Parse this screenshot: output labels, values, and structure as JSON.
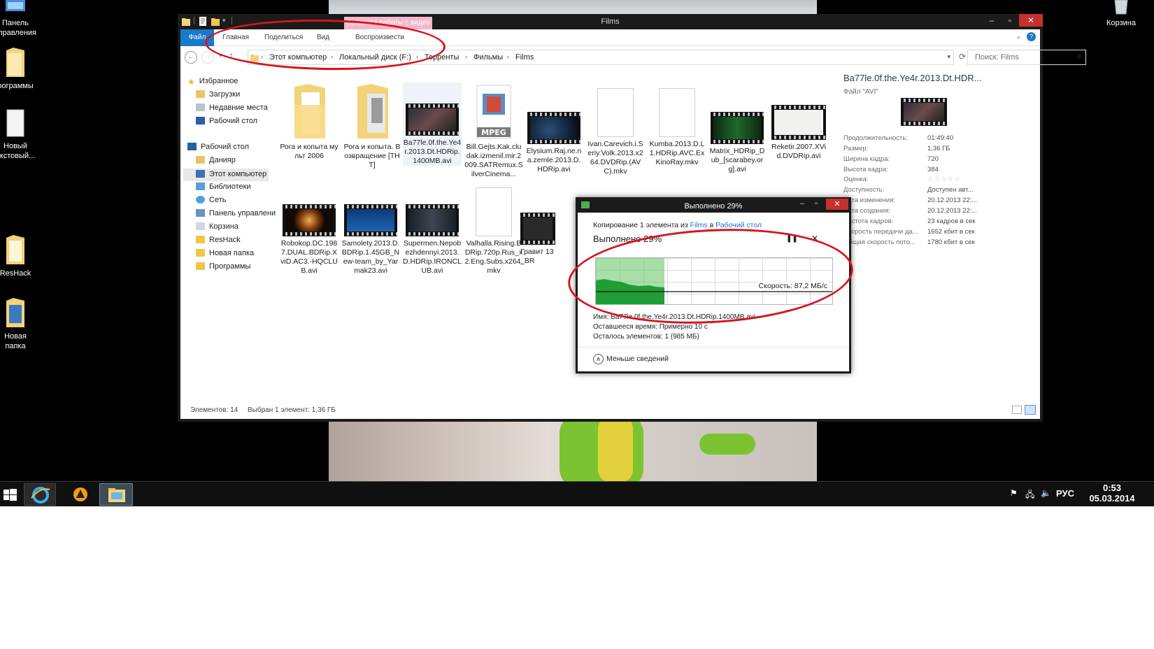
{
  "desktop": {
    "icons_left": [
      {
        "label": "Панель\nуправления",
        "icon": "control-panel-icon"
      },
      {
        "label": "рограммы",
        "icon": "folder-icon"
      },
      {
        "label": "Новый\nекстовый...",
        "icon": "text-document-icon"
      },
      {
        "label": "ResHack",
        "icon": "folder-icon"
      },
      {
        "label": "Новая\nпапка",
        "icon": "folder-icon"
      }
    ],
    "recycle_bin_label": "Корзина"
  },
  "explorer": {
    "title": "Films",
    "context_tab": "Средства работы с видео",
    "ribbon_tabs": [
      "Файл",
      "Главная",
      "Поделиться",
      "Вид",
      "Воспроизвести"
    ],
    "breadcrumb": [
      "Этот компьютер",
      "Локальный диск (F:)",
      "Торренты",
      "Фильмы",
      "Films"
    ],
    "search_placeholder": "Поиск: Films",
    "nav": [
      {
        "label": "Избранное",
        "icon": "star-icon"
      },
      {
        "label": "Загрузки",
        "icon": "downloads-icon"
      },
      {
        "label": "Недавние места",
        "icon": "recent-places-icon"
      },
      {
        "label": "Рабочий стол",
        "icon": "desktop-icon"
      },
      {
        "label": "Рабочий стол",
        "icon": "desktop-icon"
      },
      {
        "label": "Данияр",
        "icon": "user-folder-icon"
      },
      {
        "label": "Этот компьютер",
        "icon": "computer-icon"
      },
      {
        "label": "Библиотеки",
        "icon": "libraries-icon"
      },
      {
        "label": "Сеть",
        "icon": "network-icon"
      },
      {
        "label": "Панель управлени",
        "icon": "control-panel-icon"
      },
      {
        "label": "Корзина",
        "icon": "recycle-bin-icon"
      },
      {
        "label": "ResHack",
        "icon": "folder-icon"
      },
      {
        "label": "Новая папка",
        "icon": "folder-icon"
      },
      {
        "label": "Программы",
        "icon": "folder-icon"
      }
    ],
    "files_row1": [
      {
        "name": "Рога и копыта мульт 2006",
        "kind": "folder"
      },
      {
        "name": "Рога и копыта. Возвращение [ТНТ]",
        "kind": "folder"
      },
      {
        "name": "Ba77le.0f.the.Ye4r.2013.Dt.HDRip.1400MB.avi",
        "kind": "video"
      },
      {
        "name": "Bill.Gejts.Kak.cludak.izmenil.mir.2009.SATRemux.SilverCinema...",
        "kind": "mpeg"
      },
      {
        "name": "Elysium.Raj.ne.na.zemle.2013.D.HDRip.avi",
        "kind": "video"
      },
      {
        "name": "Ivan.Carevich.i.Seriy.Volk.2013.x264.DVDRip.(AVC).mkv",
        "kind": "doc"
      },
      {
        "name": "Kumba.2013.D.L1.HDRip.AVC.ExKinoRay.mkv",
        "kind": "doc"
      },
      {
        "name": "Matrix_HDRip_Dub_[scarabey.org].avi",
        "kind": "video"
      },
      {
        "name": "Reketir.2007.XVid.DVDRip.avi",
        "kind": "video"
      }
    ],
    "files_row2": [
      {
        "name": "Robokop.DC.1987.DUAL.BDRip.XviD.AC3.-HQCLUB.avi",
        "kind": "video"
      },
      {
        "name": "Samolety.2013.D.BDRip.1.45GB_New-team_by_Yarmak23.avi",
        "kind": "video"
      },
      {
        "name": "Supermen.Nepobezhdennyi.2013.D.HDRip.IRONCLUB.avi",
        "kind": "video"
      },
      {
        "name": "Valhalla.Rising.BDRip.720p.Rus_x2.Eng.Subs.x264.mkv",
        "kind": "doc"
      },
      {
        "name": "Гравит 13_BR",
        "kind": "video"
      }
    ],
    "details": {
      "filename": "Ba77le.0f.the.Ye4r.2013.Dt.HDR...",
      "filetype": "Файл \"AVI\"",
      "props": [
        {
          "k": "Продолжительность:",
          "v": "01:49:40"
        },
        {
          "k": "Размер:",
          "v": "1,36 ГБ"
        },
        {
          "k": "Ширина кадра:",
          "v": "720"
        },
        {
          "k": "Высота кадра:",
          "v": "384"
        },
        {
          "k": "Оценка:",
          "v": "☆☆☆☆☆"
        },
        {
          "k": "Доступность:",
          "v": "Доступен авт..."
        },
        {
          "k": "Дата изменения:",
          "v": "20.12.2013 22:..."
        },
        {
          "k": "Дата создания:",
          "v": "20.12.2013 22:..."
        },
        {
          "k": "Частота кадров:",
          "v": "23 кадров в сек"
        },
        {
          "k": "Скорость передачи да...",
          "v": "1652 кбит в сек"
        },
        {
          "k": "Общая скорость пото...",
          "v": "1780 кбит в сек"
        }
      ]
    },
    "status": {
      "count": "Элементов: 14",
      "selected": "Выбран 1 элемент: 1,36 ГБ"
    }
  },
  "copy_dialog": {
    "title": "Выполнено 29%",
    "from_prefix": "Копирование 1 элемента из ",
    "from_link": "Films",
    "to_word": " в ",
    "to_link": "Рабочий стол",
    "progress_text": "Выполнено 29%",
    "progress_percent": 29,
    "speed": "Скорость: 87,2 МБ/с",
    "name_line": "Имя: Ba77le.0f.the.Ye4r.2013.Dt.HDRip.1400MB.avi",
    "remaining_time": "Оставшееся время: Примерно 10 с",
    "remaining_items": "Осталось элементов: 1 (985 МБ)",
    "less_details": "Меньше сведений"
  },
  "taskbar": {
    "lang": "РУС",
    "time": "0:53",
    "date": "05.03.2014"
  },
  "colors": {
    "accent": "#1979ca",
    "progress_green": "#20a33a",
    "annotation_red": "#d7141d"
  }
}
